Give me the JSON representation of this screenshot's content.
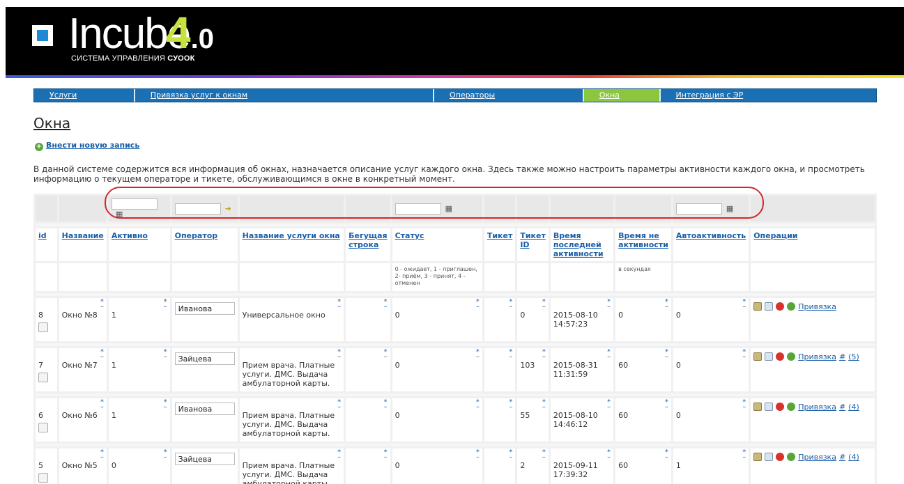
{
  "header": {
    "logo_text": "Incube",
    "version_major": "4",
    "version_minor": ".0",
    "subtitle_prefix": "СИСТЕМА УПРАВЛЕНИЯ ",
    "subtitle_brand": "СУООК"
  },
  "nav": [
    {
      "label": "Услуги",
      "active": false
    },
    {
      "label": "Привязка услуг к окнам",
      "active": false
    },
    {
      "label": "Операторы",
      "active": false
    },
    {
      "label": "Окна",
      "active": true
    },
    {
      "label": "Интеграция с ЭР",
      "active": false
    }
  ],
  "page": {
    "title": "Окна",
    "add_link": "Внести новую запись",
    "description": "В данной системе содержится вся информация об окнах, назначается описание услуг каждого окна. Здесь также можно настроить параметры активности каждого окна, и просмотреть информацию о текущем операторе и тикете, обслуживающимся в окне в конкретный момент."
  },
  "table": {
    "headers": [
      "id",
      "Название",
      "Активно",
      "Оператор",
      "Название услуги окна",
      "Бегущая строка",
      "Статус",
      "Тикет",
      "Тикет ID",
      "Время последней активности",
      "Время не активности",
      "Автоактивность",
      "Операции"
    ],
    "hints": {
      "status": "0 - ожидает, 1 - приглашен, 2- приём, 3 - принят, 4 - отменен",
      "inactive": "в секундах"
    },
    "ops": {
      "link_label": "Привязка",
      "hash_label": "#"
    },
    "rows": [
      {
        "id": "8",
        "name": "Окно №8",
        "active": "1",
        "operator": "Иванова",
        "service": "Универсальное окно",
        "ticker": "",
        "status": "0",
        "ticket": "",
        "ticket_id": "0",
        "last_activity": "2015-08-10 14:57:23",
        "inactive": "0",
        "auto": "0",
        "count": ""
      },
      {
        "id": "7",
        "name": "Окно №7",
        "active": "1",
        "operator": "Зайцева",
        "service": "Прием врача. Платные услуги. ДМС. Выдача амбулаторной карты.",
        "ticker": "",
        "status": "0",
        "ticket": "",
        "ticket_id": "103",
        "last_activity": "2015-08-31 11:31:59",
        "inactive": "60",
        "auto": "0",
        "count": "(5)"
      },
      {
        "id": "6",
        "name": "Окно №6",
        "active": "1",
        "operator": "Иванова",
        "service": "Прием врача. Платные услуги. ДМС. Выдача амбулаторной карты.",
        "ticker": "",
        "status": "0",
        "ticket": "",
        "ticket_id": "55",
        "last_activity": "2015-08-10 14:46:12",
        "inactive": "60",
        "auto": "0",
        "count": "(4)"
      },
      {
        "id": "5",
        "name": "Окно №5",
        "active": "0",
        "operator": "Зайцева",
        "service": "Прием врача. Платные услуги. ДМС. Выдача амбулаторной карты.",
        "ticker": "",
        "status": "0",
        "ticket": "",
        "ticket_id": "2",
        "last_activity": "2015-09-11 17:39:32",
        "inactive": "60",
        "auto": "1",
        "count": "(4)"
      }
    ]
  },
  "icons": {
    "calendar": "calendar-icon",
    "go": "arrow-go-icon",
    "edit": "edit-icon",
    "copy": "copy-icon",
    "delete": "delete-icon",
    "add": "add-icon"
  },
  "colors": {
    "nav_bg": "#1b6fb3",
    "nav_active": "#8cc63f",
    "link": "#1a5fa8",
    "highlight_oval": "#d3272a"
  }
}
